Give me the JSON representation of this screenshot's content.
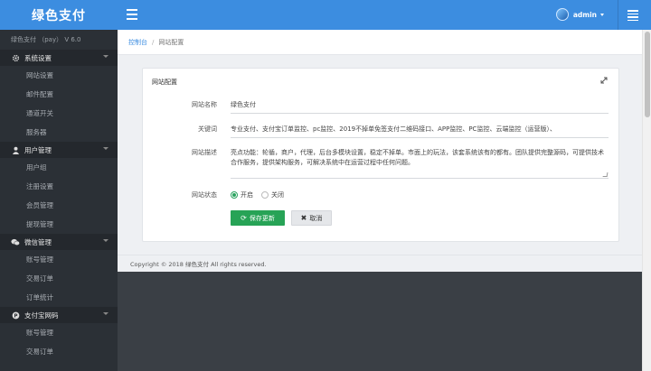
{
  "brand": "绿色支付",
  "version": "绿色支付 （pay） V 6.0",
  "sidebar": {
    "groups": [
      {
        "title": "系统设置",
        "icon": "gear-icon",
        "items": [
          "网站设置",
          "邮件配置",
          "通道开关",
          "服务器"
        ]
      },
      {
        "title": "用户管理",
        "icon": "user-icon",
        "items": [
          "用户组",
          "注册设置",
          "会员管理",
          "提现管理"
        ]
      },
      {
        "title": "微信管理",
        "icon": "wechat-icon",
        "items": [
          "账号管理",
          "交易订单",
          "订单统计"
        ]
      },
      {
        "title": "支付宝网码",
        "icon": "alipay-icon",
        "items": [
          "账号管理",
          "交易订单"
        ]
      }
    ]
  },
  "header": {
    "username": "admin"
  },
  "breadcrumb": {
    "home": "控制台",
    "separator": "/",
    "current": "网站配置"
  },
  "panel": {
    "title": "网站配置",
    "fields": {
      "name_label": "网站名称",
      "name_value": "绿色支付",
      "keywords_label": "关键词",
      "keywords_value": "专业支付、支付宝订单监控、pc监控、2019不掉单免签支付二维码接口、APP监控、PC监控、云端监控（运营版）、",
      "desc_label": "网站描述",
      "desc_value": "亮点功能：轮循，商户，代理，后台多模块设置，稳定不掉单。市面上的玩法，该套系统该有的都有。团队提供完整源码，可提供技术合作服务，提供架构服务，可解决系统中在运营过程中任何问题。",
      "status_label": "网站状态",
      "status_on": "开启",
      "status_off": "关闭",
      "status_selected": "on"
    },
    "save_label": "保存更新",
    "cancel_label": "取消"
  },
  "footer": "Copyright © 2018 绿色支付 All rights reserved."
}
